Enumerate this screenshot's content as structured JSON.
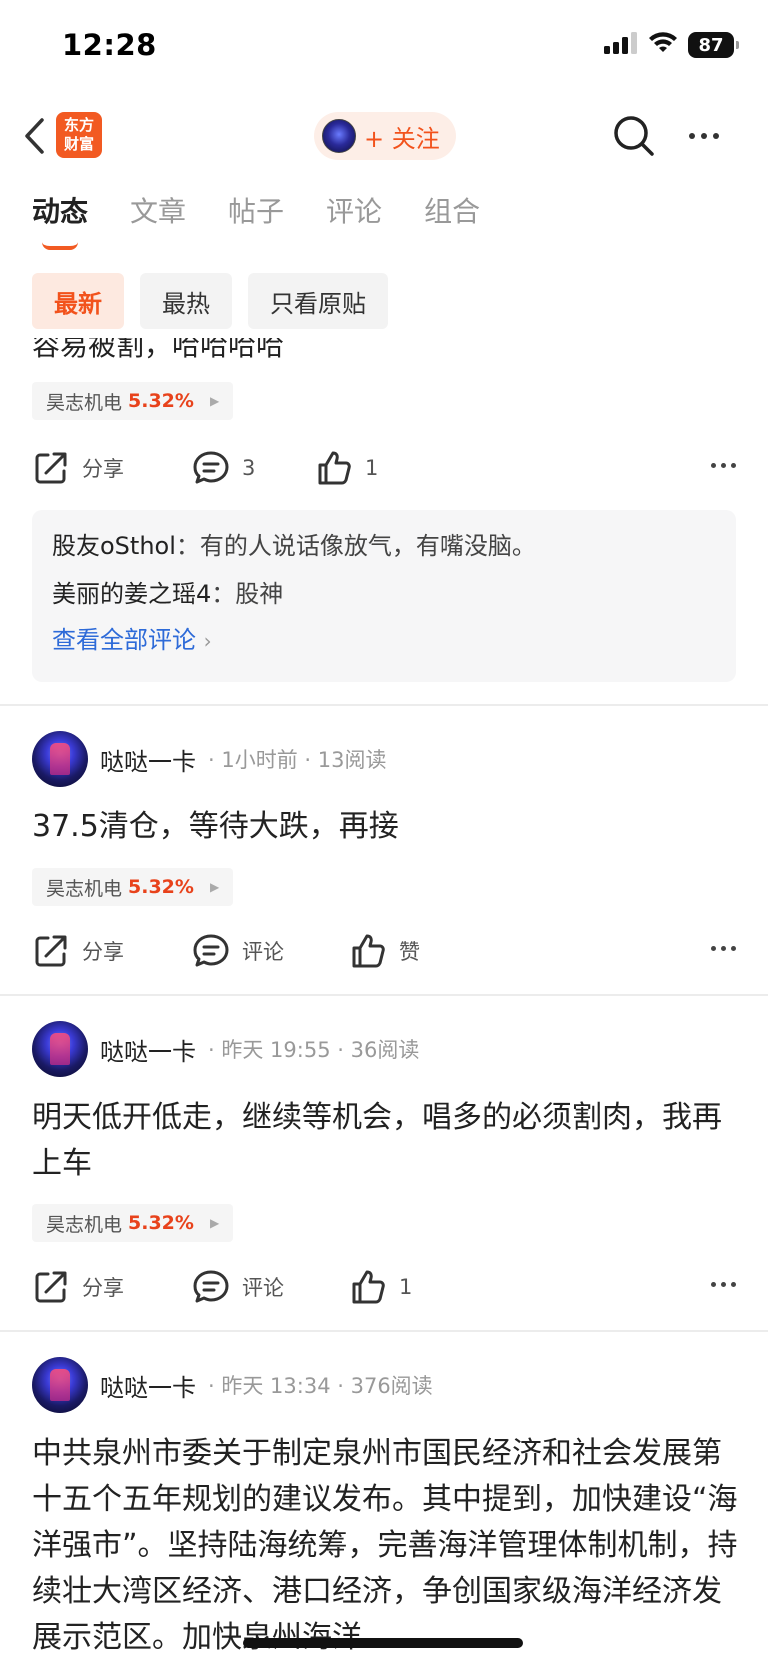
{
  "status": {
    "time": "12:28",
    "battery": "87"
  },
  "nav": {
    "logo_line1": "东方",
    "logo_line2": "财富",
    "follow_label": "+ 关注"
  },
  "tabs": [
    "动态",
    "文章",
    "帖子",
    "评论",
    "组合"
  ],
  "filters": [
    "最新",
    "最热",
    "只看原贴"
  ],
  "post0": {
    "clipped_text": "容易被割，哈哈哈哈",
    "stock_name": "昊志机电",
    "stock_change": "5.32%",
    "share_label": "分享",
    "comment_count": "3",
    "like_count": "1",
    "comments": [
      {
        "user": "股友oSthol",
        "text": "有的人说话像放气，有嘴没脑。"
      },
      {
        "user": "美丽的姜之瑶4",
        "text": "股神"
      }
    ],
    "view_all": "查看全部评论"
  },
  "post1": {
    "author": "哒哒一卡",
    "time": "1小时前",
    "reads": "13阅读",
    "text": "37.5清仓，等待大跌，再接",
    "stock_name": "昊志机电",
    "stock_change": "5.32%",
    "share_label": "分享",
    "comment_label": "评论",
    "like_label": "赞"
  },
  "post2": {
    "author": "哒哒一卡",
    "time": "昨天 19:55",
    "reads": "36阅读",
    "text": "明天低开低走，继续等机会，唱多的必须割肉，我再上车",
    "stock_name": "昊志机电",
    "stock_change": "5.32%",
    "share_label": "分享",
    "comment_label": "评论",
    "like_count": "1"
  },
  "post3": {
    "author": "哒哒一卡",
    "time": "昨天 13:34",
    "reads": "376阅读",
    "text": "中共泉州市委关于制定泉州市国民经济和社会发展第十五个五年规划的建议发布。其中提到，加快建设“海洋强市”。坚持陆海统筹，完善海洋管理体制机制，持续壮大湾区经济、港口经济，争创国家级海洋经济发展示范区。加快泉州海洋"
  },
  "colors": {
    "accent": "#f2521c",
    "link": "#2d6ad8",
    "stock_up": "#e8421b"
  },
  "icons": [
    "back-chevron-icon",
    "search-icon",
    "more-dots-icon",
    "share-icon",
    "comment-icon",
    "like-icon",
    "signal-icon",
    "wifi-icon",
    "battery-icon"
  ]
}
